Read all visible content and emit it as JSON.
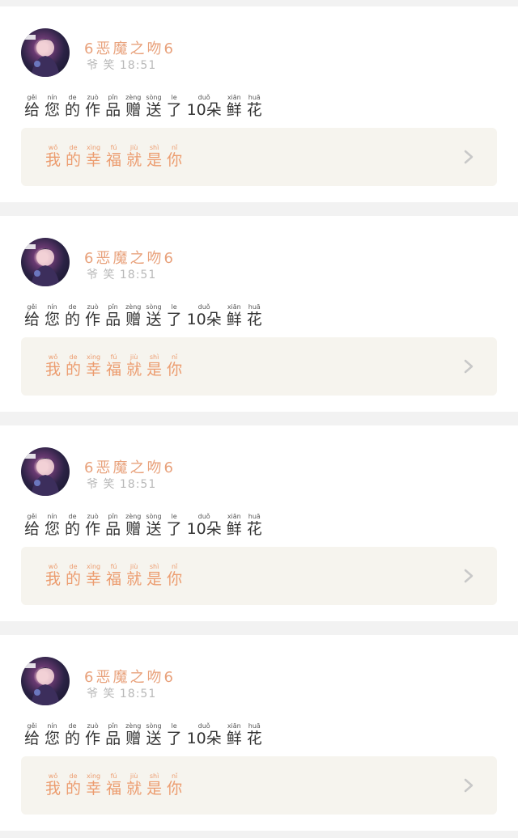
{
  "feed": {
    "posts": [
      {
        "username": "6恶魔之吻6",
        "time": "爷 笑 18:51",
        "text": {
          "tokens": [
            {
              "ch": "给",
              "py": "gěi"
            },
            {
              "ch": "您",
              "py": "nín"
            },
            {
              "ch": "的",
              "py": "de"
            },
            {
              "ch": "作",
              "py": "zuò"
            },
            {
              "ch": "品",
              "py": "pǐn"
            },
            {
              "ch": "赠",
              "py": "zèng"
            },
            {
              "ch": "送",
              "py": "sòng"
            },
            {
              "ch": "了",
              "py": "le"
            },
            {
              "ch": "10朵",
              "py": "duǒ"
            },
            {
              "ch": "鲜",
              "py": "xiān"
            },
            {
              "ch": "花",
              "py": "huā"
            }
          ]
        },
        "banner": {
          "tokens": [
            {
              "ch": "我",
              "py": "wǒ"
            },
            {
              "ch": "的",
              "py": "de"
            },
            {
              "ch": "幸",
              "py": "xìng"
            },
            {
              "ch": "福",
              "py": "fú"
            },
            {
              "ch": "就",
              "py": "jiù"
            },
            {
              "ch": "是",
              "py": "shì"
            },
            {
              "ch": "你",
              "py": "nǐ"
            }
          ]
        },
        "avatar_icon": "anime-avatar-icon",
        "chevron_icon": "chevron-right-icon"
      },
      {
        "username": "6恶魔之吻6",
        "time": "爷 笑 18:51",
        "text": {
          "tokens": [
            {
              "ch": "给",
              "py": "gěi"
            },
            {
              "ch": "您",
              "py": "nín"
            },
            {
              "ch": "的",
              "py": "de"
            },
            {
              "ch": "作",
              "py": "zuò"
            },
            {
              "ch": "品",
              "py": "pǐn"
            },
            {
              "ch": "赠",
              "py": "zèng"
            },
            {
              "ch": "送",
              "py": "sòng"
            },
            {
              "ch": "了",
              "py": "le"
            },
            {
              "ch": "10朵",
              "py": "duǒ"
            },
            {
              "ch": "鲜",
              "py": "xiān"
            },
            {
              "ch": "花",
              "py": "huā"
            }
          ]
        },
        "banner": {
          "tokens": [
            {
              "ch": "我",
              "py": "wǒ"
            },
            {
              "ch": "的",
              "py": "de"
            },
            {
              "ch": "幸",
              "py": "xìng"
            },
            {
              "ch": "福",
              "py": "fú"
            },
            {
              "ch": "就",
              "py": "jiù"
            },
            {
              "ch": "是",
              "py": "shì"
            },
            {
              "ch": "你",
              "py": "nǐ"
            }
          ]
        },
        "avatar_icon": "anime-avatar-icon",
        "chevron_icon": "chevron-right-icon"
      },
      {
        "username": "6恶魔之吻6",
        "time": "爷 笑 18:51",
        "text": {
          "tokens": [
            {
              "ch": "给",
              "py": "gěi"
            },
            {
              "ch": "您",
              "py": "nín"
            },
            {
              "ch": "的",
              "py": "de"
            },
            {
              "ch": "作",
              "py": "zuò"
            },
            {
              "ch": "品",
              "py": "pǐn"
            },
            {
              "ch": "赠",
              "py": "zèng"
            },
            {
              "ch": "送",
              "py": "sòng"
            },
            {
              "ch": "了",
              "py": "le"
            },
            {
              "ch": "10朵",
              "py": "duǒ"
            },
            {
              "ch": "鲜",
              "py": "xiān"
            },
            {
              "ch": "花",
              "py": "huā"
            }
          ]
        },
        "banner": {
          "tokens": [
            {
              "ch": "我",
              "py": "wǒ"
            },
            {
              "ch": "的",
              "py": "de"
            },
            {
              "ch": "幸",
              "py": "xìng"
            },
            {
              "ch": "福",
              "py": "fú"
            },
            {
              "ch": "就",
              "py": "jiù"
            },
            {
              "ch": "是",
              "py": "shì"
            },
            {
              "ch": "你",
              "py": "nǐ"
            }
          ]
        },
        "avatar_icon": "anime-avatar-icon",
        "chevron_icon": "chevron-right-icon"
      },
      {
        "username": "6恶魔之吻6",
        "time": "爷 笑 18:51",
        "text": {
          "tokens": [
            {
              "ch": "给",
              "py": "gěi"
            },
            {
              "ch": "您",
              "py": "nín"
            },
            {
              "ch": "的",
              "py": "de"
            },
            {
              "ch": "作",
              "py": "zuò"
            },
            {
              "ch": "品",
              "py": "pǐn"
            },
            {
              "ch": "赠",
              "py": "zèng"
            },
            {
              "ch": "送",
              "py": "sòng"
            },
            {
              "ch": "了",
              "py": "le"
            },
            {
              "ch": "10朵",
              "py": "duǒ"
            },
            {
              "ch": "鲜",
              "py": "xiān"
            },
            {
              "ch": "花",
              "py": "huā"
            }
          ]
        },
        "banner": {
          "tokens": [
            {
              "ch": "我",
              "py": "wǒ"
            },
            {
              "ch": "的",
              "py": "de"
            },
            {
              "ch": "幸",
              "py": "xìng"
            },
            {
              "ch": "福",
              "py": "fú"
            },
            {
              "ch": "就",
              "py": "jiù"
            },
            {
              "ch": "是",
              "py": "shì"
            },
            {
              "ch": "你",
              "py": "nǐ"
            }
          ]
        },
        "avatar_icon": "anime-avatar-icon",
        "chevron_icon": "chevron-right-icon"
      }
    ]
  },
  "colors": {
    "background": "#f2f2f2",
    "card": "#ffffff",
    "username": "#e8a17b",
    "time": "#b8b8b8",
    "body_text": "#333333",
    "banner_bg": "#f6f4ee",
    "banner_text": "#ec9c6f",
    "chevron": "#c8c8c8"
  }
}
